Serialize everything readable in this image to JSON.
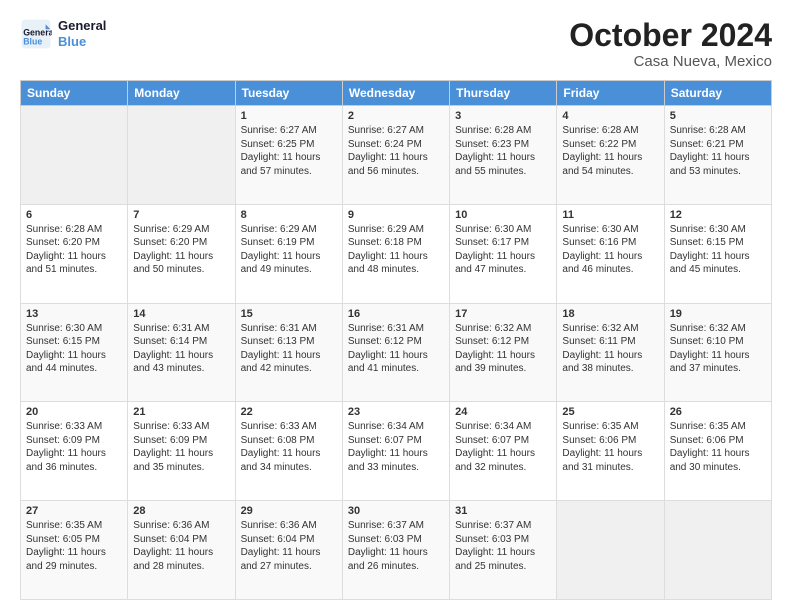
{
  "logo": {
    "line1": "General",
    "line2": "Blue"
  },
  "title": "October 2024",
  "subtitle": "Casa Nueva, Mexico",
  "days_of_week": [
    "Sunday",
    "Monday",
    "Tuesday",
    "Wednesday",
    "Thursday",
    "Friday",
    "Saturday"
  ],
  "weeks": [
    [
      {
        "day": "",
        "info": ""
      },
      {
        "day": "",
        "info": ""
      },
      {
        "day": "1",
        "info": "Sunrise: 6:27 AM\nSunset: 6:25 PM\nDaylight: 11 hours and 57 minutes."
      },
      {
        "day": "2",
        "info": "Sunrise: 6:27 AM\nSunset: 6:24 PM\nDaylight: 11 hours and 56 minutes."
      },
      {
        "day": "3",
        "info": "Sunrise: 6:28 AM\nSunset: 6:23 PM\nDaylight: 11 hours and 55 minutes."
      },
      {
        "day": "4",
        "info": "Sunrise: 6:28 AM\nSunset: 6:22 PM\nDaylight: 11 hours and 54 minutes."
      },
      {
        "day": "5",
        "info": "Sunrise: 6:28 AM\nSunset: 6:21 PM\nDaylight: 11 hours and 53 minutes."
      }
    ],
    [
      {
        "day": "6",
        "info": "Sunrise: 6:28 AM\nSunset: 6:20 PM\nDaylight: 11 hours and 51 minutes."
      },
      {
        "day": "7",
        "info": "Sunrise: 6:29 AM\nSunset: 6:20 PM\nDaylight: 11 hours and 50 minutes."
      },
      {
        "day": "8",
        "info": "Sunrise: 6:29 AM\nSunset: 6:19 PM\nDaylight: 11 hours and 49 minutes."
      },
      {
        "day": "9",
        "info": "Sunrise: 6:29 AM\nSunset: 6:18 PM\nDaylight: 11 hours and 48 minutes."
      },
      {
        "day": "10",
        "info": "Sunrise: 6:30 AM\nSunset: 6:17 PM\nDaylight: 11 hours and 47 minutes."
      },
      {
        "day": "11",
        "info": "Sunrise: 6:30 AM\nSunset: 6:16 PM\nDaylight: 11 hours and 46 minutes."
      },
      {
        "day": "12",
        "info": "Sunrise: 6:30 AM\nSunset: 6:15 PM\nDaylight: 11 hours and 45 minutes."
      }
    ],
    [
      {
        "day": "13",
        "info": "Sunrise: 6:30 AM\nSunset: 6:15 PM\nDaylight: 11 hours and 44 minutes."
      },
      {
        "day": "14",
        "info": "Sunrise: 6:31 AM\nSunset: 6:14 PM\nDaylight: 11 hours and 43 minutes."
      },
      {
        "day": "15",
        "info": "Sunrise: 6:31 AM\nSunset: 6:13 PM\nDaylight: 11 hours and 42 minutes."
      },
      {
        "day": "16",
        "info": "Sunrise: 6:31 AM\nSunset: 6:12 PM\nDaylight: 11 hours and 41 minutes."
      },
      {
        "day": "17",
        "info": "Sunrise: 6:32 AM\nSunset: 6:12 PM\nDaylight: 11 hours and 39 minutes."
      },
      {
        "day": "18",
        "info": "Sunrise: 6:32 AM\nSunset: 6:11 PM\nDaylight: 11 hours and 38 minutes."
      },
      {
        "day": "19",
        "info": "Sunrise: 6:32 AM\nSunset: 6:10 PM\nDaylight: 11 hours and 37 minutes."
      }
    ],
    [
      {
        "day": "20",
        "info": "Sunrise: 6:33 AM\nSunset: 6:09 PM\nDaylight: 11 hours and 36 minutes."
      },
      {
        "day": "21",
        "info": "Sunrise: 6:33 AM\nSunset: 6:09 PM\nDaylight: 11 hours and 35 minutes."
      },
      {
        "day": "22",
        "info": "Sunrise: 6:33 AM\nSunset: 6:08 PM\nDaylight: 11 hours and 34 minutes."
      },
      {
        "day": "23",
        "info": "Sunrise: 6:34 AM\nSunset: 6:07 PM\nDaylight: 11 hours and 33 minutes."
      },
      {
        "day": "24",
        "info": "Sunrise: 6:34 AM\nSunset: 6:07 PM\nDaylight: 11 hours and 32 minutes."
      },
      {
        "day": "25",
        "info": "Sunrise: 6:35 AM\nSunset: 6:06 PM\nDaylight: 11 hours and 31 minutes."
      },
      {
        "day": "26",
        "info": "Sunrise: 6:35 AM\nSunset: 6:06 PM\nDaylight: 11 hours and 30 minutes."
      }
    ],
    [
      {
        "day": "27",
        "info": "Sunrise: 6:35 AM\nSunset: 6:05 PM\nDaylight: 11 hours and 29 minutes."
      },
      {
        "day": "28",
        "info": "Sunrise: 6:36 AM\nSunset: 6:04 PM\nDaylight: 11 hours and 28 minutes."
      },
      {
        "day": "29",
        "info": "Sunrise: 6:36 AM\nSunset: 6:04 PM\nDaylight: 11 hours and 27 minutes."
      },
      {
        "day": "30",
        "info": "Sunrise: 6:37 AM\nSunset: 6:03 PM\nDaylight: 11 hours and 26 minutes."
      },
      {
        "day": "31",
        "info": "Sunrise: 6:37 AM\nSunset: 6:03 PM\nDaylight: 11 hours and 25 minutes."
      },
      {
        "day": "",
        "info": ""
      },
      {
        "day": "",
        "info": ""
      }
    ]
  ]
}
